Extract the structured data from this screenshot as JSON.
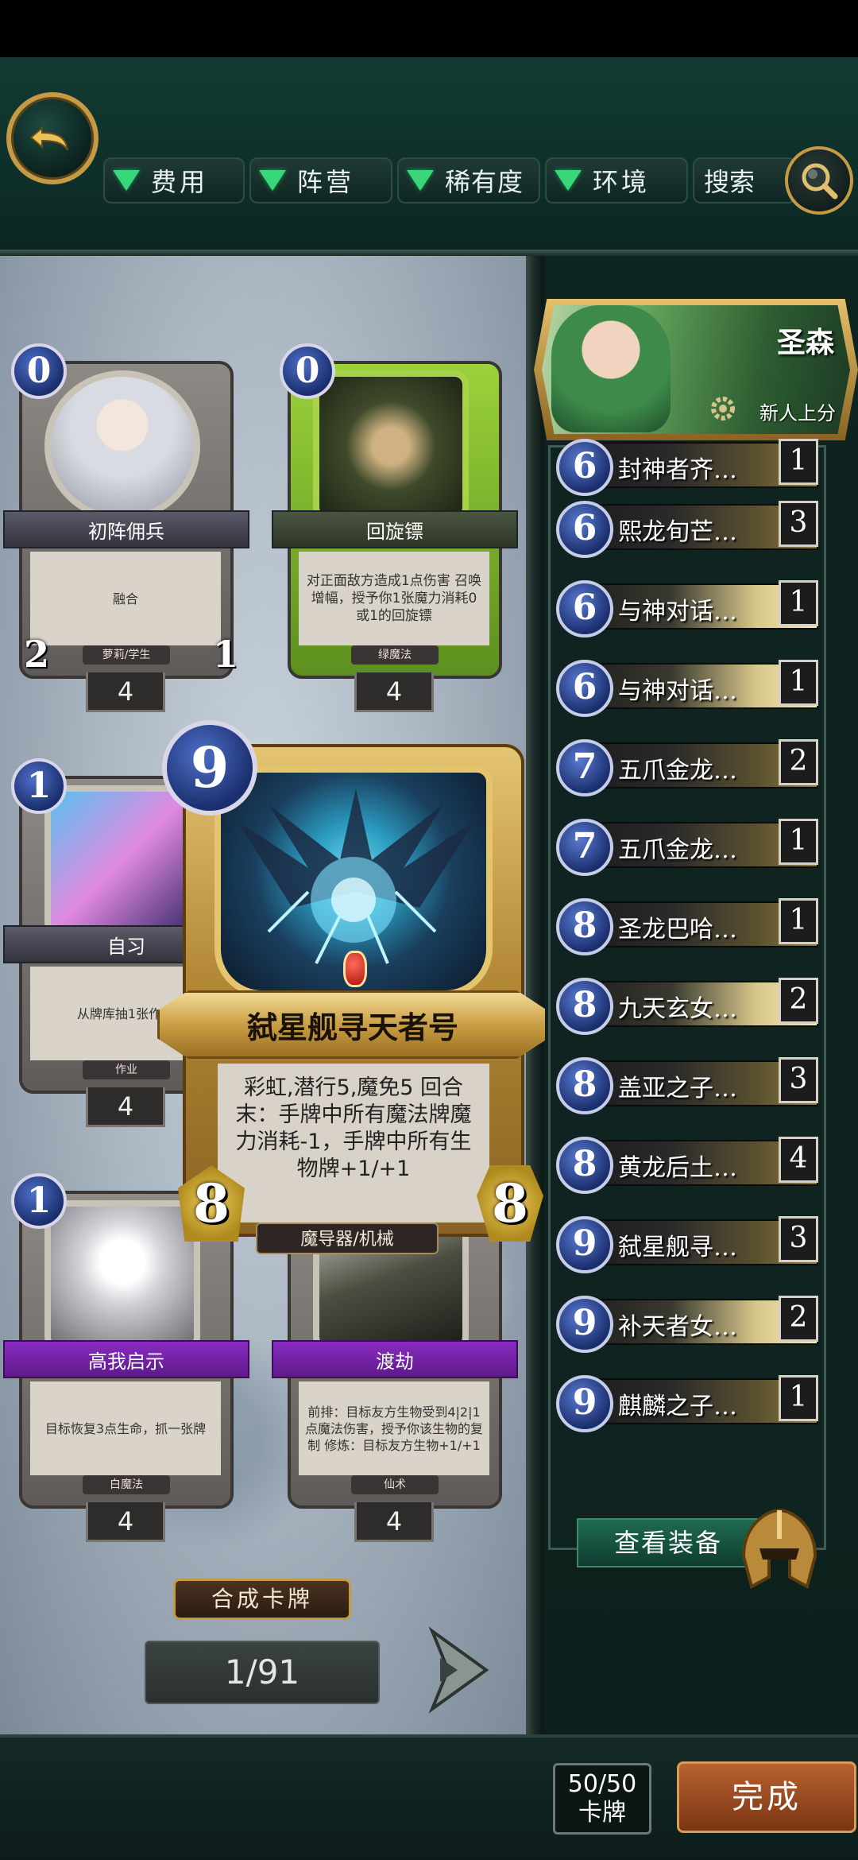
{
  "filters": [
    {
      "label": "费用"
    },
    {
      "label": "阵营"
    },
    {
      "label": "稀有度"
    },
    {
      "label": "环境"
    }
  ],
  "search": {
    "label": "搜索"
  },
  "cards": [
    {
      "name": "初阵佣兵",
      "mana": "0",
      "text": "融合",
      "tag": "萝莉/学生",
      "attack": "2",
      "health": "1",
      "count": "4"
    },
    {
      "name": "回旋镖",
      "mana": "0",
      "text": "对正面敌方造成1点伤害 召唤增幅，授予你1张魔力消耗0或1的回旋镖",
      "tag": "绿魔法",
      "count": "4"
    },
    {
      "name": "自习",
      "mana": "1",
      "text": "从牌库抽1张作业",
      "tag": "作业",
      "count": "4"
    },
    {
      "name": "高我启示",
      "mana": "1",
      "text": "目标恢复3点生命，抓一张牌",
      "tag": "白魔法",
      "count": "4"
    },
    {
      "name": "渡劫",
      "mana": "",
      "text": "前排：目标友方生物受到4|2|1点魔法伤害，授予你该生物的复制 修炼：目标友方生物+1/+1",
      "tag": "仙术",
      "count": "4"
    }
  ],
  "featured": {
    "name": "弑星舰寻天者号",
    "mana": "9",
    "text": "彩虹,潜行5,魔免5 回合末：手牌中所有魔法牌魔力消耗-1，手牌中所有生物牌+1/+1",
    "tag": "魔导器/机械",
    "attack": "8",
    "health": "8"
  },
  "synth_label": "合成卡牌",
  "pager": "1/91",
  "hero": {
    "name": "圣森",
    "subtitle": "新人上分"
  },
  "deck": [
    {
      "cost": "6",
      "name": "封神者齐…",
      "count": "1"
    },
    {
      "cost": "6",
      "name": "熙龙旬芒…",
      "count": "3"
    },
    {
      "cost": "6",
      "name": "与神对话…",
      "count": "1"
    },
    {
      "cost": "6",
      "name": "与神对话…",
      "count": "1"
    },
    {
      "cost": "7",
      "name": "五爪金龙…",
      "count": "2"
    },
    {
      "cost": "7",
      "name": "五爪金龙…",
      "count": "1"
    },
    {
      "cost": "8",
      "name": "圣龙巴哈…",
      "count": "1"
    },
    {
      "cost": "8",
      "name": "九天玄女…",
      "count": "2"
    },
    {
      "cost": "8",
      "name": "盖亚之子…",
      "count": "3"
    },
    {
      "cost": "8",
      "name": "黄龙后土…",
      "count": "4"
    },
    {
      "cost": "9",
      "name": "弑星舰寻…",
      "count": "3"
    },
    {
      "cost": "9",
      "name": "补天者女…",
      "count": "2"
    },
    {
      "cost": "9",
      "name": "麒麟之子…",
      "count": "1"
    }
  ],
  "equip_label": "查看装备",
  "deck_count": {
    "value": "50/50",
    "unit": "卡牌"
  },
  "done_label": "完成",
  "colors": {
    "accent_gold": "#c59a44",
    "filter_green": "#38d77a",
    "mana_blue": "#1b2f6e",
    "done_orange": "#b86230"
  }
}
